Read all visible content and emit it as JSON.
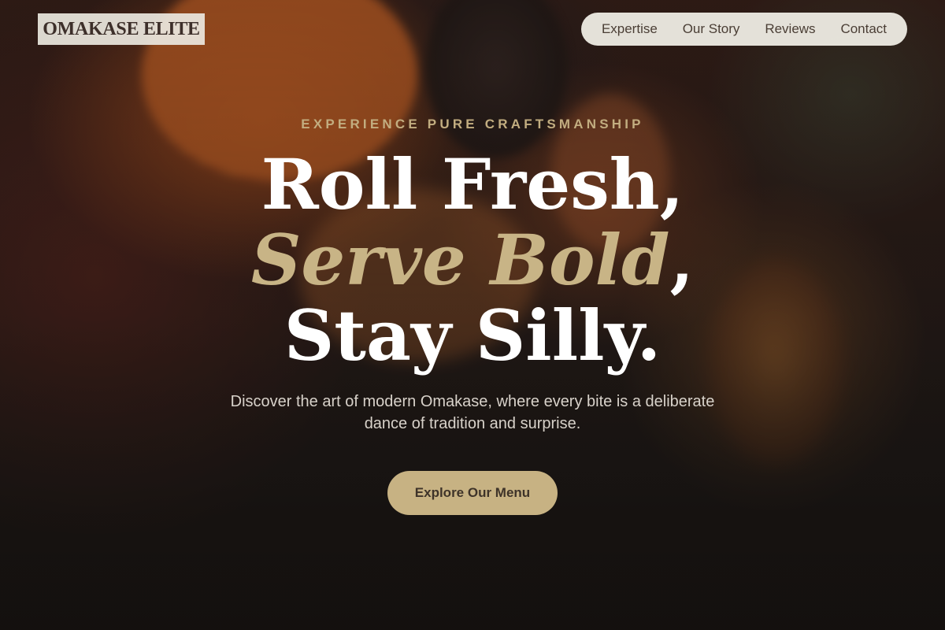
{
  "brand": {
    "logo_text": "OMAKASE ELITE"
  },
  "nav": {
    "items": [
      {
        "label": "Expertise"
      },
      {
        "label": "Our Story"
      },
      {
        "label": "Reviews"
      },
      {
        "label": "Contact"
      }
    ]
  },
  "hero": {
    "eyebrow": "EXPERIENCE PURE CRAFTSMANSHIP",
    "headline_line1": "Roll Fresh,",
    "headline_line2_accent": "Serve Bold",
    "headline_line2_comma": ",",
    "headline_line3": "Stay Silly.",
    "subtitle": "Discover the art of modern Omakase, where every bite is a deliberate dance of tradition and surprise.",
    "cta_label": "Explore Our Menu"
  },
  "colors": {
    "accent_gold": "#c7b283",
    "headline_white": "#ffffff",
    "nav_bg": "#eeece4"
  }
}
